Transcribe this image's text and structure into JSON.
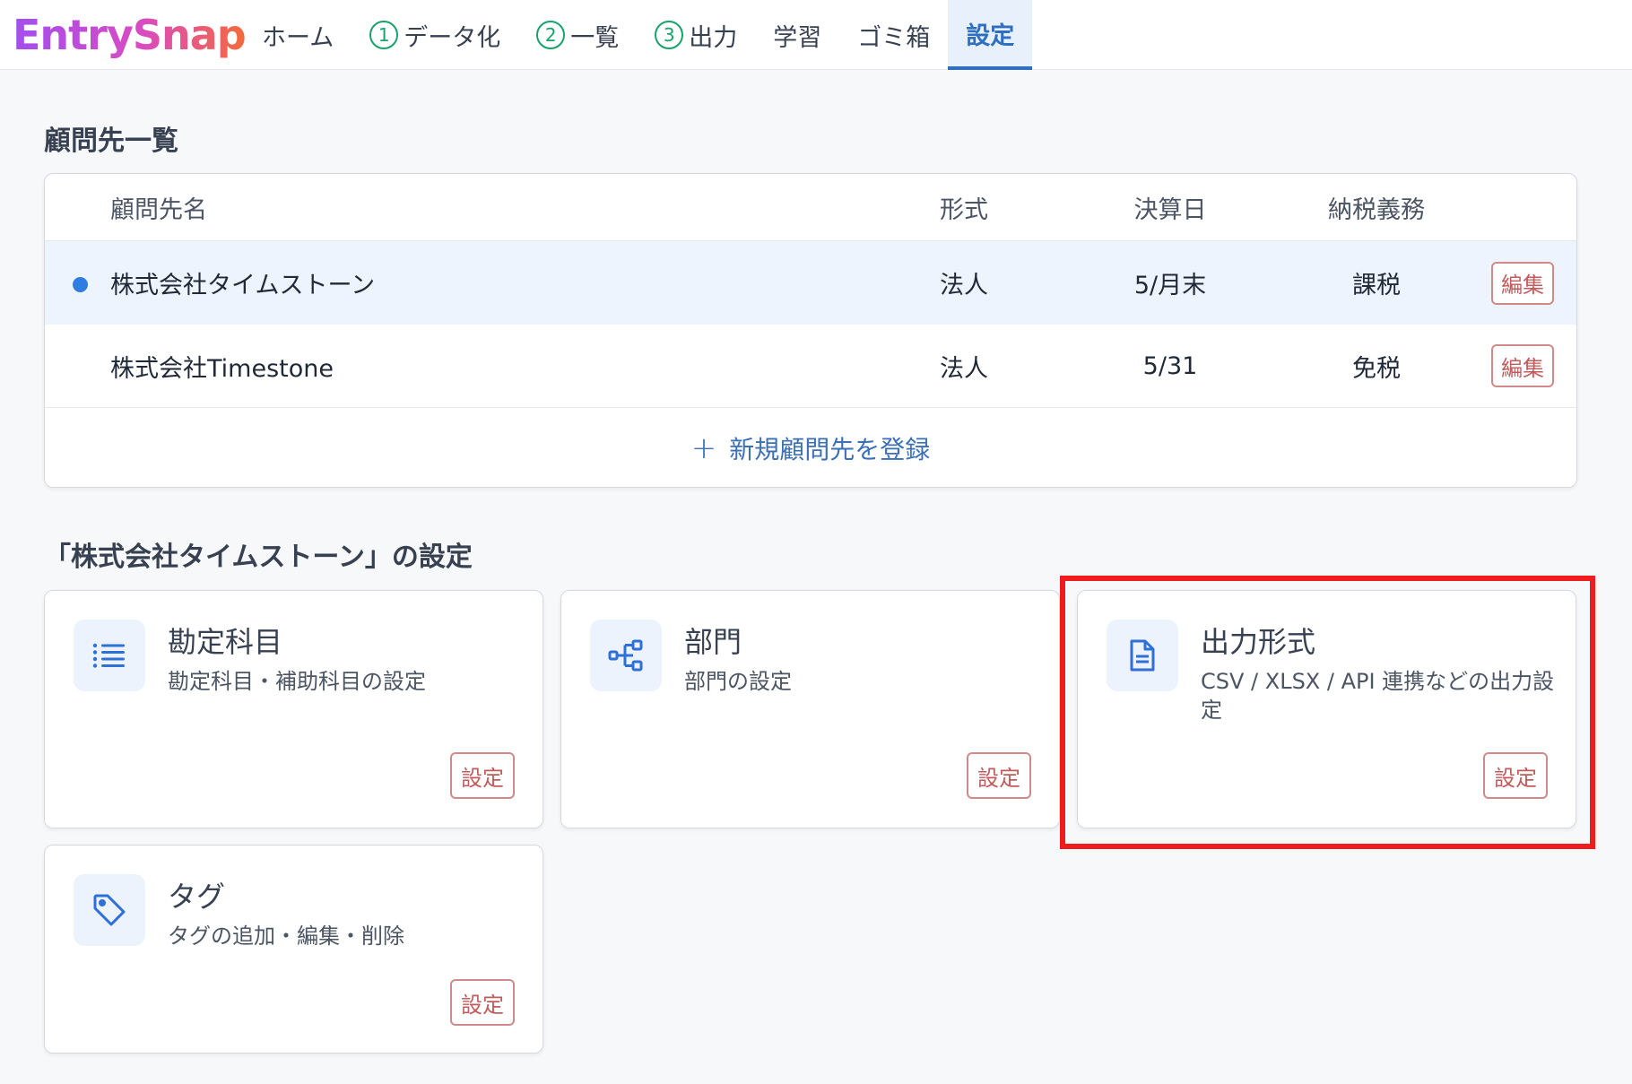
{
  "app": {
    "logo": "EntrySnap"
  },
  "nav": {
    "home": "ホーム",
    "step1_num": "1",
    "step1": "データ化",
    "step2_num": "2",
    "step2": "一覧",
    "step3_num": "3",
    "step3": "出力",
    "learn": "学習",
    "trash": "ゴミ箱",
    "settings": "設定",
    "active": "settings"
  },
  "clients": {
    "title": "顧問先一覧",
    "headers": {
      "name": "顧問先名",
      "form": "形式",
      "closing": "決算日",
      "tax": "納税義務"
    },
    "rows": [
      {
        "name": "株式会社タイムストーン",
        "form": "法人",
        "closing": "5/月末",
        "tax": "課税",
        "edit": "編集",
        "selected": true
      },
      {
        "name": "株式会社Timestone",
        "form": "法人",
        "closing": "5/31",
        "tax": "免税",
        "edit": "編集",
        "selected": false
      }
    ],
    "add_label": "新規顧問先を登録"
  },
  "settings": {
    "title": "「株式会社タイムストーン」の設定",
    "cards": [
      {
        "title": "勘定科目",
        "desc": "勘定科目・補助科目の設定",
        "button": "設定",
        "icon": "list-icon"
      },
      {
        "title": "部門",
        "desc": "部門の設定",
        "button": "設定",
        "icon": "org-chart-icon"
      },
      {
        "title": "出力形式",
        "desc": "CSV / XLSX / API 連携などの出力設定",
        "button": "設定",
        "icon": "document-icon",
        "highlighted": true
      },
      {
        "title": "タグ",
        "desc": "タグの追加・編集・削除",
        "button": "設定",
        "icon": "tag-icon"
      }
    ]
  },
  "colors": {
    "accent": "#2f6fbf",
    "step_green": "#16a36a",
    "edit_red": "#c25c5c",
    "highlight_red": "#ee1c1c",
    "selected_row": "#eef4fd"
  }
}
